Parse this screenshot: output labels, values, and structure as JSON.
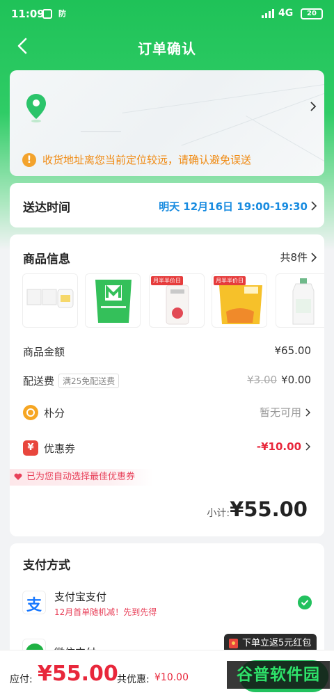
{
  "status_bar": {
    "time": "11:09",
    "icon_badge": "防",
    "network": "4G",
    "battery": "20"
  },
  "nav": {
    "title": "订单确认",
    "back_icon": "chevron-left-icon"
  },
  "address": {
    "pin_icon": "location-pin-icon",
    "warning_text": "收货地址离您当前定位较远，请确认避免误送",
    "warning_icon": "exclamation-icon"
  },
  "delivery": {
    "label": "送达时间",
    "value": "明天 12月16日 19:00-19:30"
  },
  "goods": {
    "title": "商品信息",
    "count": "共8件",
    "thumb_badge": "月半半价日",
    "rows": {
      "amount_label": "商品金额",
      "amount_value": "¥65.00",
      "shipping_label": "配送费",
      "shipping_tag": "满25免配送费",
      "shipping_original": "¥3.00",
      "shipping_value": "¥0.00",
      "points_label": "朴分",
      "points_value": "暂无可用",
      "coupon_label": "优惠券",
      "coupon_icon_text": "¥",
      "coupon_value": "-¥10.00"
    },
    "auto_tip": "已为您自动选择最佳优惠券",
    "subtotal_label": "小计:",
    "subtotal_value": "¥55.00"
  },
  "payment": {
    "title": "支付方式",
    "alipay_icon_text": "支",
    "alipay_name": "支付宝支付",
    "alipay_promo": "12月首单随机减！先到先得",
    "wechat_name": "微信支付"
  },
  "bottom": {
    "pay_label": "应付:",
    "pay_amount": "¥55.00",
    "save_label": "共优惠:",
    "save_amount": "¥10.00",
    "promo_bubble": "下单立返5元红包",
    "watermark": "谷普软件园"
  },
  "colors": {
    "brand_green": "#22c15e",
    "price_red": "#e8273b",
    "time_blue": "#1a8ce0",
    "warning_orange": "#f08a12"
  }
}
